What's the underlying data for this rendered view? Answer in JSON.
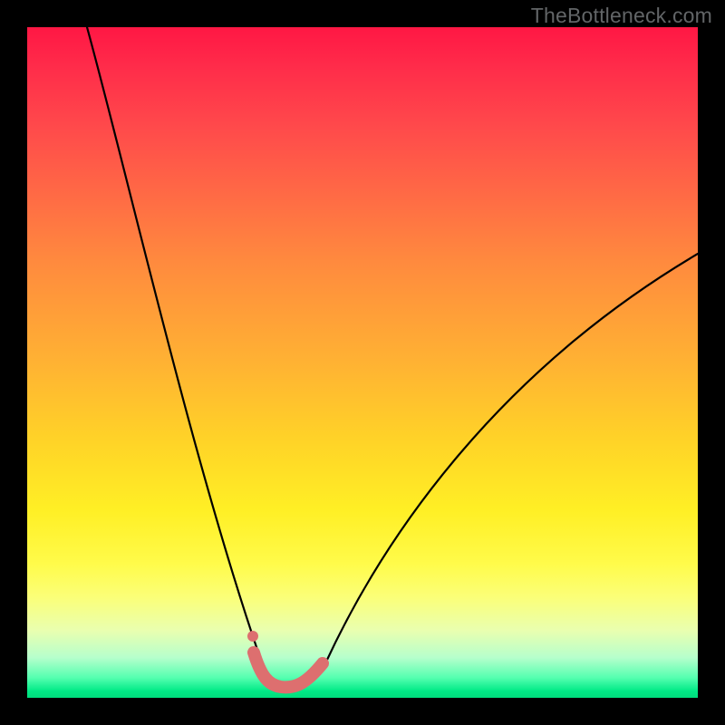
{
  "watermark": "TheBottleneck.com",
  "chart_data": {
    "type": "line",
    "title": "",
    "xlabel": "",
    "ylabel": "",
    "xlim": [
      0,
      100
    ],
    "ylim": [
      0,
      100
    ],
    "grid": false,
    "legend": false,
    "annotations": [],
    "series": [
      {
        "name": "left-branch",
        "color": "#000000",
        "x": [
          9,
          12,
          15,
          18,
          21,
          24,
          27,
          30,
          32,
          34,
          35.5,
          36.5
        ],
        "y": [
          100,
          88,
          76,
          64,
          52,
          40,
          28,
          17,
          9,
          4,
          2,
          1.5
        ]
      },
      {
        "name": "right-branch",
        "color": "#000000",
        "x": [
          43,
          45,
          48,
          52,
          57,
          62,
          68,
          75,
          82,
          90,
          97,
          100
        ],
        "y": [
          1.5,
          3,
          7,
          14,
          22,
          30,
          38,
          46,
          53,
          59,
          64,
          66
        ]
      },
      {
        "name": "valley-highlight",
        "color": "#e57373",
        "x": [
          34,
          36,
          38,
          40,
          42,
          44
        ],
        "y": [
          6,
          2,
          1,
          1,
          2,
          4
        ]
      },
      {
        "name": "highlight-dot",
        "color": "#e57373",
        "type": "scatter",
        "x": [
          34
        ],
        "y": [
          9
        ]
      }
    ],
    "gradient_stops": [
      {
        "pos": 0,
        "color": "#ff1744"
      },
      {
        "pos": 50,
        "color": "#ffb233"
      },
      {
        "pos": 80,
        "color": "#fffb4a"
      },
      {
        "pos": 100,
        "color": "#00dd7d"
      }
    ]
  }
}
